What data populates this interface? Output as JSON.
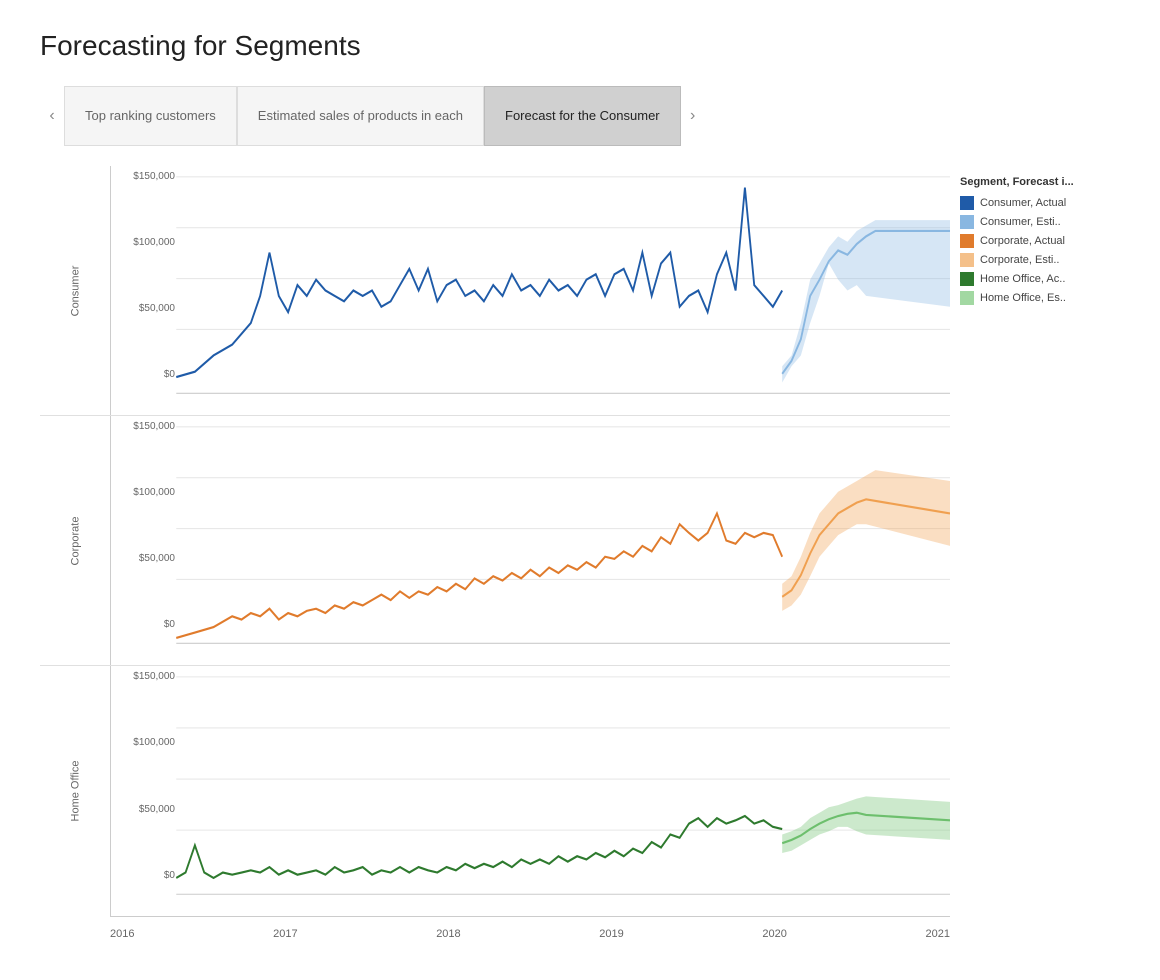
{
  "title": "Forecasting for Segments",
  "tabs": [
    {
      "id": "top-ranking",
      "label": "Top ranking customers",
      "active": false
    },
    {
      "id": "estimated-sales",
      "label": "Estimated sales of products in each",
      "active": false
    },
    {
      "id": "forecast-consumer",
      "label": "Forecast for the Consumer",
      "active": true
    }
  ],
  "nav": {
    "prev_label": "‹",
    "next_label": "›"
  },
  "legend": {
    "title": "Segment, Forecast i...",
    "items": [
      {
        "label": "Consumer, Actual",
        "color": "#1f5ba8",
        "type": "solid"
      },
      {
        "label": "Consumer, Esti..",
        "color": "#89b7e1",
        "type": "solid"
      },
      {
        "label": "Corporate, Actual",
        "color": "#e07b2c",
        "type": "solid"
      },
      {
        "label": "Corporate, Esti..",
        "color": "#f4c08a",
        "type": "solid"
      },
      {
        "label": "Home Office, Ac..",
        "color": "#2e7a2e",
        "type": "solid"
      },
      {
        "label": "Home Office, Es..",
        "color": "#a2d8a2",
        "type": "solid"
      }
    ]
  },
  "panels": [
    {
      "id": "consumer",
      "label": "Consumer",
      "color_actual": "#1f5ba8",
      "color_est": "#89b7e1",
      "color_band": "rgba(137,183,225,0.35)"
    },
    {
      "id": "corporate",
      "label": "Corporate",
      "color_actual": "#e07b2c",
      "color_est": "#e8a05a",
      "color_band": "rgba(240,160,80,0.35)"
    },
    {
      "id": "home-office",
      "label": "Home Office",
      "color_actual": "#2e7a2e",
      "color_est": "#6dbf6d",
      "color_band": "rgba(109,191,109,0.35)"
    }
  ],
  "x_labels": [
    "2016",
    "2017",
    "2018",
    "2019",
    "2020",
    "2021"
  ],
  "y_labels": [
    "$150,000",
    "$100,000",
    "$50,000",
    "$0"
  ]
}
